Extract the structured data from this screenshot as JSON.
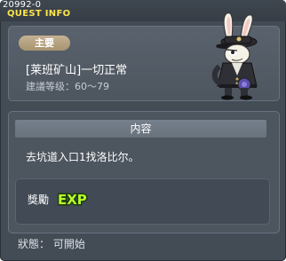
{
  "window": {
    "quest_id": "20992-0",
    "title": "QUEST INFO"
  },
  "header": {
    "category": "主要",
    "quest_name": "[莱班矿山]一切正常",
    "level_requirement": "建議等级：60～79",
    "npc_icon": "rabbit-officer-npc"
  },
  "content": {
    "section_title": "内容",
    "description": "去坑道入口1找洛比尔。"
  },
  "reward": {
    "label": "獎勵",
    "exp_icon_text": "EXP",
    "exp_color": "#b6ff2a"
  },
  "status": {
    "text": "狀態： 可開始"
  }
}
